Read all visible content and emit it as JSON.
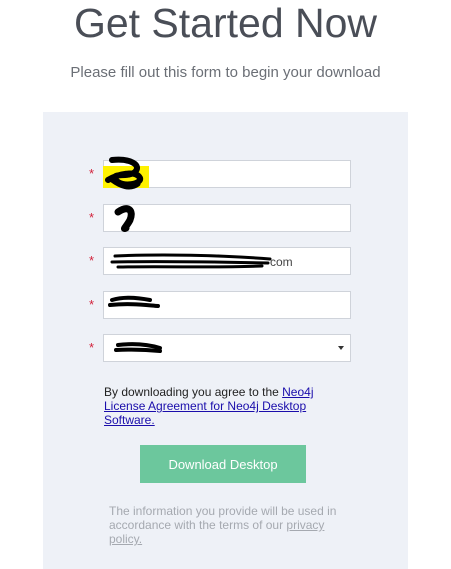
{
  "header": {
    "title": "Get Started Now",
    "subtitle": "Please fill out this form to begin your download"
  },
  "form": {
    "required_marker": "*",
    "fields": [
      {
        "name": "first-name",
        "value": ""
      },
      {
        "name": "last-name",
        "value": ""
      },
      {
        "name": "email",
        "value": "com"
      },
      {
        "name": "company",
        "value": ""
      },
      {
        "name": "country",
        "value": ""
      }
    ],
    "agreement_prefix": "By downloading you agree to the ",
    "agreement_link": "Neo4j License Agreement for Neo4j Desktop Software.",
    "download_button": "Download Desktop",
    "privacy_note": "The information you provide will be used in accordance with the terms of our ",
    "privacy_link": "privacy policy."
  },
  "colors": {
    "panel_background": "#eef1f7",
    "button": "#6cc79d",
    "required": "#d2213a",
    "link": "#1a0dab",
    "highlight": "#fff200"
  }
}
